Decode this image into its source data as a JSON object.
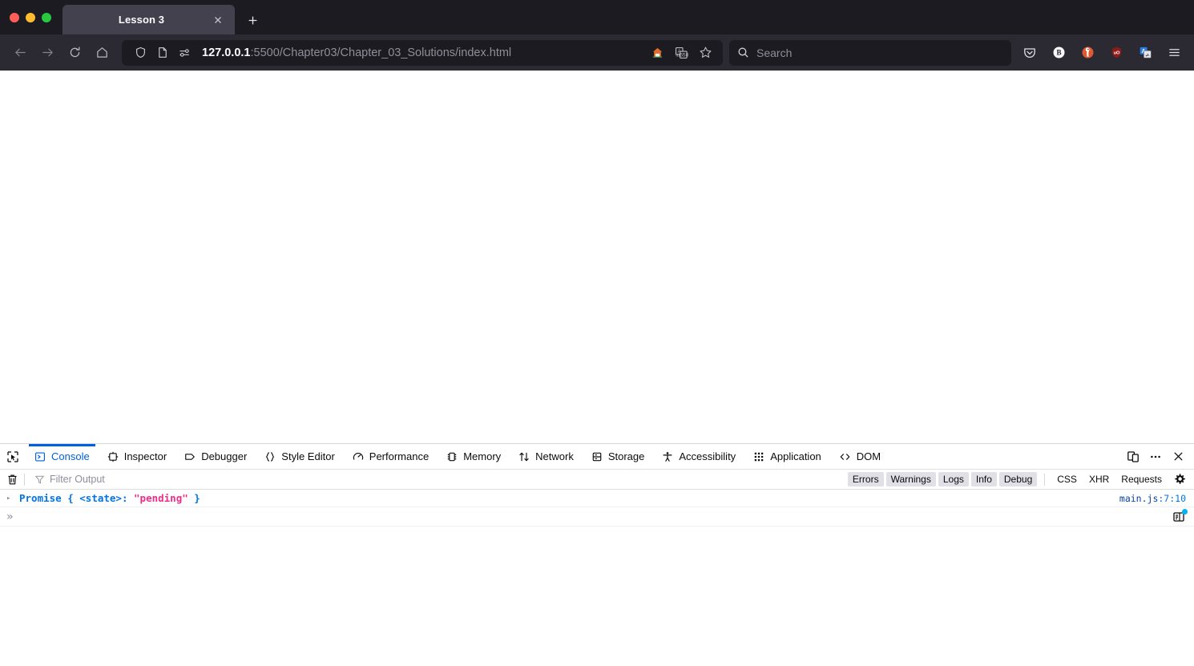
{
  "window": {
    "traffic_lights": [
      "close",
      "minimize",
      "maximize"
    ],
    "colors": {
      "close": "#ff5f57",
      "minimize": "#febc2e",
      "maximize": "#28c840",
      "chrome_bg": "#2b2a33",
      "tabbar_bg": "#1c1b22",
      "tab_active_bg": "#42414d",
      "devtools_accent": "#0060df"
    }
  },
  "tabs": {
    "items": [
      {
        "title": "Lesson 3",
        "close_label": "✕",
        "active": true
      }
    ],
    "new_tab_label": "+"
  },
  "navigation": {
    "back_icon": "arrow-left-icon",
    "forward_icon": "arrow-right-icon",
    "reload_icon": "reload-icon",
    "home_icon": "home-icon"
  },
  "urlbar": {
    "shield_icon": "shield-icon",
    "reader_icon": "reader-mode-icon",
    "permissions_icon": "page-settings-icon",
    "host": "127.0.0.1",
    "path": ":5500/Chapter03/Chapter_03_Solutions/index.html",
    "full_url": "127.0.0.1:5500/Chapter03/Chapter_03_Solutions/index.html",
    "actions": [
      {
        "name": "home-page-action-icon",
        "glyph": "🏠"
      },
      {
        "name": "translate-page-icon",
        "glyph": "translate"
      },
      {
        "name": "bookmark-star-icon",
        "glyph": "☆"
      }
    ]
  },
  "search": {
    "placeholder": "Search",
    "icon": "search-icon"
  },
  "extensions": [
    {
      "name": "pocket-icon",
      "label": ""
    },
    {
      "name": "bitwarden-icon",
      "label": "B"
    },
    {
      "name": "duckduckgo-icon",
      "label": ""
    },
    {
      "name": "ublock-origin-icon",
      "label": "uO"
    },
    {
      "name": "translate-extension-icon",
      "label": "A"
    },
    {
      "name": "app-menu-icon",
      "label": ""
    }
  ],
  "devtools": {
    "picker_icon": "element-picker-icon",
    "tabs": [
      {
        "label": "Console",
        "icon": "console-icon",
        "active": true
      },
      {
        "label": "Inspector",
        "icon": "inspector-icon",
        "active": false
      },
      {
        "label": "Debugger",
        "icon": "debugger-icon",
        "active": false
      },
      {
        "label": "Style Editor",
        "icon": "style-editor-icon",
        "active": false
      },
      {
        "label": "Performance",
        "icon": "performance-icon",
        "active": false
      },
      {
        "label": "Memory",
        "icon": "memory-icon",
        "active": false
      },
      {
        "label": "Network",
        "icon": "network-icon",
        "active": false
      },
      {
        "label": "Storage",
        "icon": "storage-icon",
        "active": false
      },
      {
        "label": "Accessibility",
        "icon": "accessibility-icon",
        "active": false
      },
      {
        "label": "Application",
        "icon": "application-icon",
        "active": false
      },
      {
        "label": "DOM",
        "icon": "dom-icon",
        "active": false
      }
    ],
    "toolbar_actions": [
      {
        "name": "responsive-design-mode-icon"
      },
      {
        "name": "devtools-meatballs-menu-icon",
        "label": "⋯"
      },
      {
        "name": "devtools-close-icon",
        "label": "✕"
      }
    ],
    "filterbar": {
      "clear_icon": "trash-icon",
      "filter_icon": "funnel-icon",
      "filter_placeholder": "Filter Output",
      "filter_value": "",
      "toggles": [
        {
          "label": "Errors",
          "on": true
        },
        {
          "label": "Warnings",
          "on": true
        },
        {
          "label": "Logs",
          "on": true
        },
        {
          "label": "Info",
          "on": true
        },
        {
          "label": "Debug",
          "on": true
        }
      ],
      "categories": [
        {
          "label": "CSS",
          "on": false
        },
        {
          "label": "XHR",
          "on": false
        },
        {
          "label": "Requests",
          "on": false
        }
      ],
      "settings_icon": "gear-icon"
    },
    "console_output": [
      {
        "expander": "▸",
        "tokens": [
          {
            "text": "Promise { ",
            "kind": "obj"
          },
          {
            "text": "<state>",
            "kind": "obj"
          },
          {
            "text": ": ",
            "kind": "obj"
          },
          {
            "text": "\"pending\"",
            "kind": "str"
          },
          {
            "text": " }",
            "kind": "obj"
          }
        ],
        "plain": "Promise { <state>: \"pending\" }",
        "source_file": "main.js",
        "source_line": ":7:10"
      }
    ],
    "prompt": {
      "chevron": "»",
      "value": "",
      "editor_icon": "split-console-editor-icon",
      "badge": true
    }
  }
}
